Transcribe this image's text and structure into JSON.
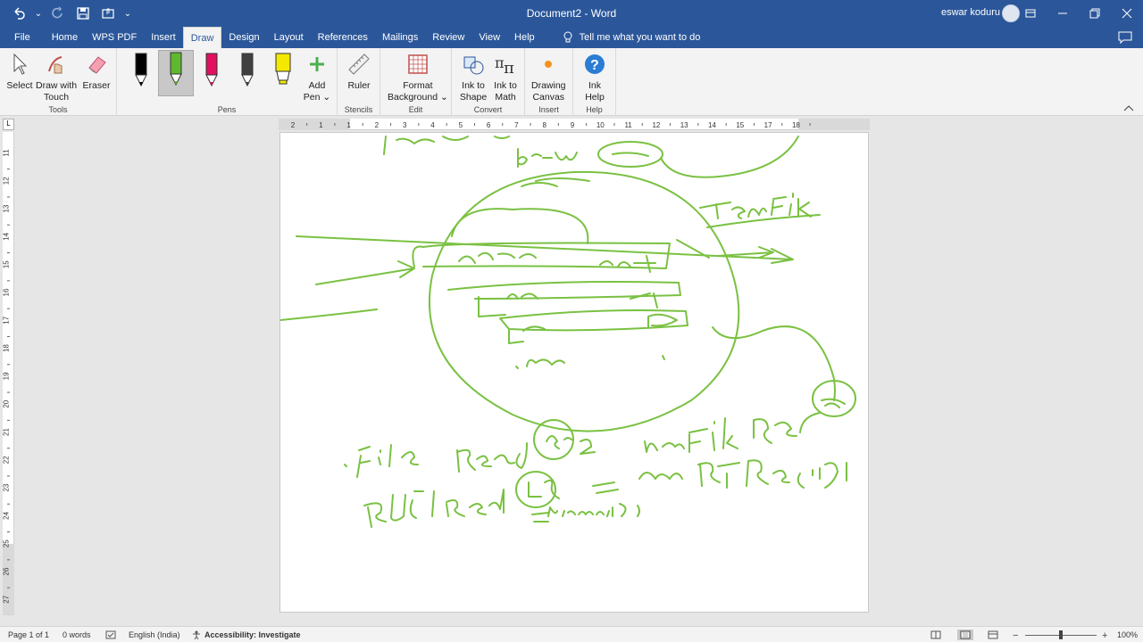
{
  "titlebar": {
    "title": "Document2  -  Word",
    "user": "eswar koduru",
    "customize_symbol": "⌄"
  },
  "tabs": [
    {
      "label": "File"
    },
    {
      "label": "Home"
    },
    {
      "label": "WPS PDF"
    },
    {
      "label": "Insert"
    },
    {
      "label": "Draw",
      "active": true
    },
    {
      "label": "Design"
    },
    {
      "label": "Layout"
    },
    {
      "label": "References"
    },
    {
      "label": "Mailings"
    },
    {
      "label": "Review"
    },
    {
      "label": "View"
    },
    {
      "label": "Help"
    }
  ],
  "tell_me": "Tell me what you want to do",
  "ribbon": {
    "tools": {
      "label": "Tools",
      "select": "Select",
      "draw_touch_1": "Draw with",
      "draw_touch_2": "Touch",
      "eraser": "Eraser"
    },
    "pens": {
      "label": "Pens",
      "add_pen_1": "Add",
      "add_pen_2": "Pen ⌄",
      "pen_colors": [
        "#000000",
        "#5fb830",
        "#e0115f",
        "#404040",
        "#f5e800"
      ]
    },
    "stencils": {
      "label": "Stencils",
      "ruler": "Ruler"
    },
    "edit": {
      "label": "Edit",
      "format_bg_1": "Format",
      "format_bg_2": "Background ⌄"
    },
    "convert": {
      "label": "Convert",
      "ink_shape_1": "Ink to",
      "ink_shape_2": "Shape",
      "ink_math_1": "Ink to",
      "ink_math_2": "Math"
    },
    "insert": {
      "label": "Insert",
      "drawing_canvas_1": "Drawing",
      "drawing_canvas_2": "Canvas"
    },
    "help": {
      "label": "Help",
      "ink_help_1": "Ink",
      "ink_help_2": "Help"
    }
  },
  "ruler": {
    "h_ticks": [
      "2",
      "1",
      "1",
      "2",
      "3",
      "4",
      "5",
      "6",
      "7",
      "8",
      "9",
      "10",
      "11",
      "12",
      "13",
      "14",
      "15",
      "17",
      "18"
    ],
    "v_ticks": [
      "11",
      "12",
      "13",
      "14",
      "15",
      "16",
      "17",
      "18",
      "19",
      "20",
      "21",
      "22",
      "23",
      "24",
      "25",
      "26",
      "27"
    ],
    "corner": "L"
  },
  "status": {
    "page": "Page 1 of 1",
    "words": "0 words",
    "language": "English (India)",
    "accessibility": "Accessibility: Investigate",
    "zoom": "100%",
    "zoom_minus": "−",
    "zoom_plus": "+"
  },
  "colors": {
    "title_blue": "#2b579a",
    "ink_green": "#7ac142"
  }
}
